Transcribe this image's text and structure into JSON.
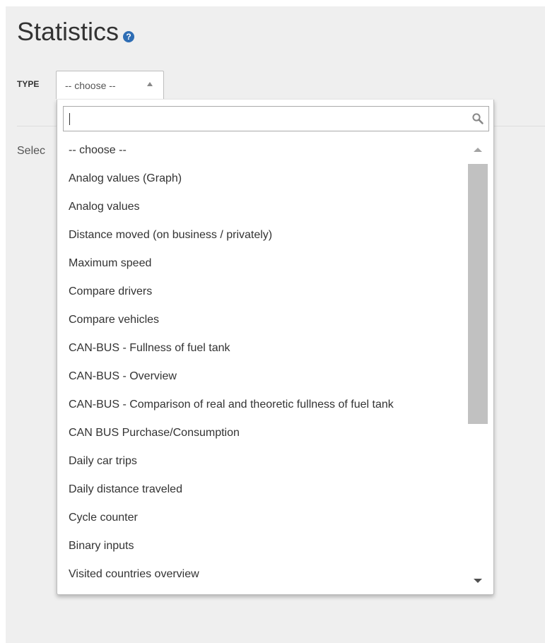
{
  "page": {
    "title": "Statistics",
    "help_icon": "question-circle-icon",
    "help_glyph": "?",
    "select_hint": "Selec"
  },
  "type_filter": {
    "label": "TYPE",
    "selected": "-- choose --",
    "search_value": "",
    "options": [
      "-- choose --",
      "Analog values (Graph)",
      "Analog values",
      "Distance moved (on business / privately)",
      "Maximum speed",
      "Compare drivers",
      "Compare vehicles",
      "CAN-BUS - Fullness of fuel tank",
      "CAN-BUS - Overview",
      "CAN-BUS - Comparison of real and theoretic fullness of fuel tank",
      "CAN BUS Purchase/Consumption",
      "Daily car trips",
      "Daily distance traveled",
      "Cycle counter",
      "Binary inputs",
      "Visited countries overview"
    ]
  },
  "colors": {
    "page_background": "#efefef",
    "help_icon": "#2e6db4",
    "scroll_thumb": "#c1c1c1"
  }
}
